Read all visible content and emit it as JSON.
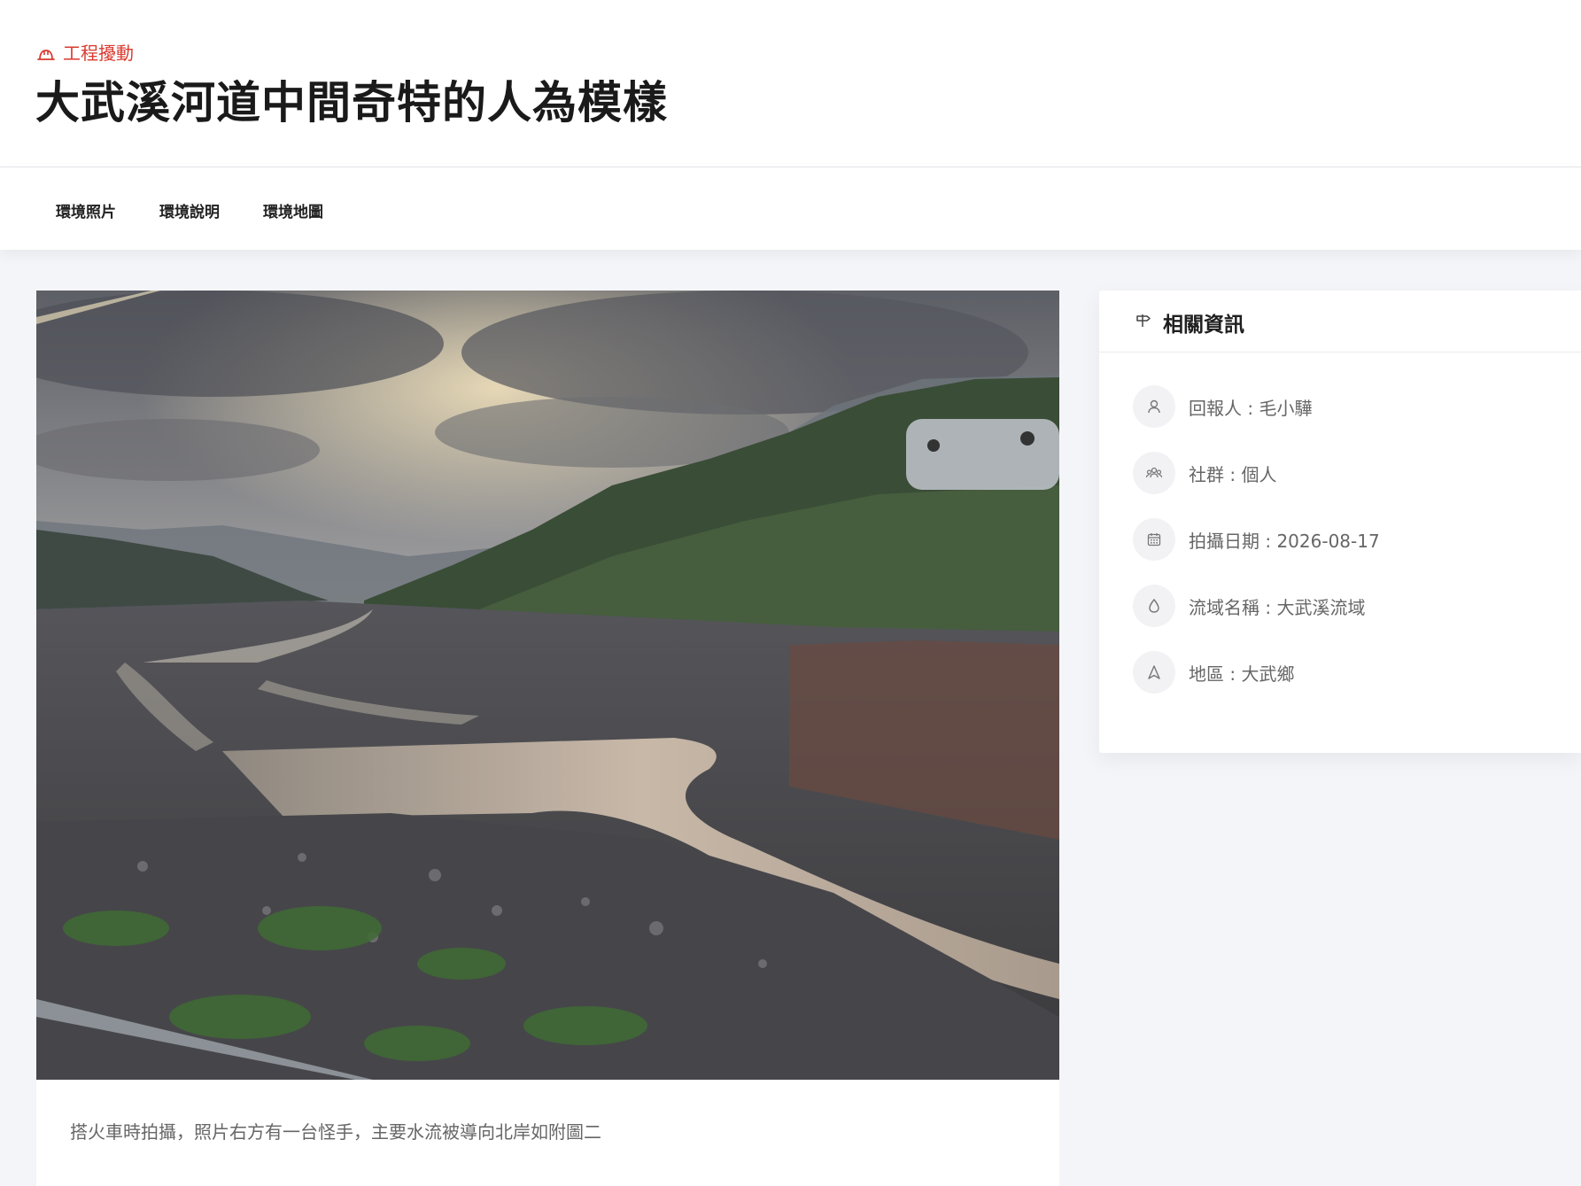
{
  "header": {
    "category": "工程擾動",
    "category_icon": "hard-hat-icon",
    "title": "大武溪河道中間奇特的人為模樣"
  },
  "tabs": [
    {
      "label": "環境照片"
    },
    {
      "label": "環境說明"
    },
    {
      "label": "環境地圖"
    }
  ],
  "photo": {
    "caption": "搭火車時拍攝，照片右方有一台怪手，主要水流被導向北岸如附圖二"
  },
  "sidebar": {
    "heading": "相關資訊",
    "heading_icon": "signpost-icon",
    "items": [
      {
        "icon": "user-icon",
        "text": "回報人 : 毛小驊"
      },
      {
        "icon": "group-icon",
        "text": "社群 : 個人"
      },
      {
        "icon": "calendar-icon",
        "text": "拍攝日期 : 2026-08-17"
      },
      {
        "icon": "water-drop-icon",
        "text": "流域名稱 : 大武溪流域"
      },
      {
        "icon": "navigation-icon",
        "text": "地區 : 大武鄉"
      }
    ]
  },
  "colors": {
    "accent": "#d93a2f",
    "background": "#f4f5f9"
  }
}
